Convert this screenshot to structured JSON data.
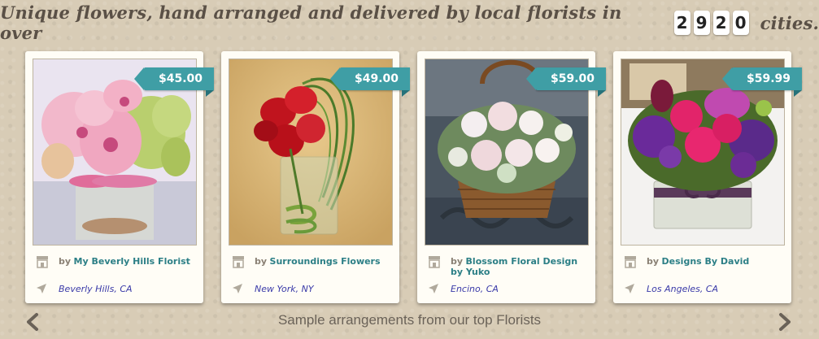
{
  "headline": {
    "prefix": "Unique flowers, hand arranged and delivered by local florists in over",
    "digits": [
      "2",
      "9",
      "2",
      "0"
    ],
    "suffix": "cities."
  },
  "cards": [
    {
      "price": "$45.00",
      "by": "by",
      "florist": "My Beverly Hills Florist",
      "city": "Beverly Hills, CA"
    },
    {
      "price": "$49.00",
      "by": "by",
      "florist": "Surroundings Flowers",
      "city": "New York, NY"
    },
    {
      "price": "$59.00",
      "by": "by",
      "florist": "Blossom Floral Design by Yuko",
      "city": "Encino, CA"
    },
    {
      "price": "$59.99",
      "by": "by",
      "florist": "Designs By David",
      "city": "Los Angeles, CA"
    }
  ],
  "footer": {
    "caption": "Sample arrangements from our top Florists"
  },
  "icons": {
    "store": "store-icon",
    "location": "location-arrow-icon",
    "prev": "chevron-left-icon",
    "next": "chevron-right-icon"
  },
  "colors": {
    "accent": "#3f9ea5",
    "florist_link": "#2c7f86",
    "city_link": "#3a3aa8"
  }
}
